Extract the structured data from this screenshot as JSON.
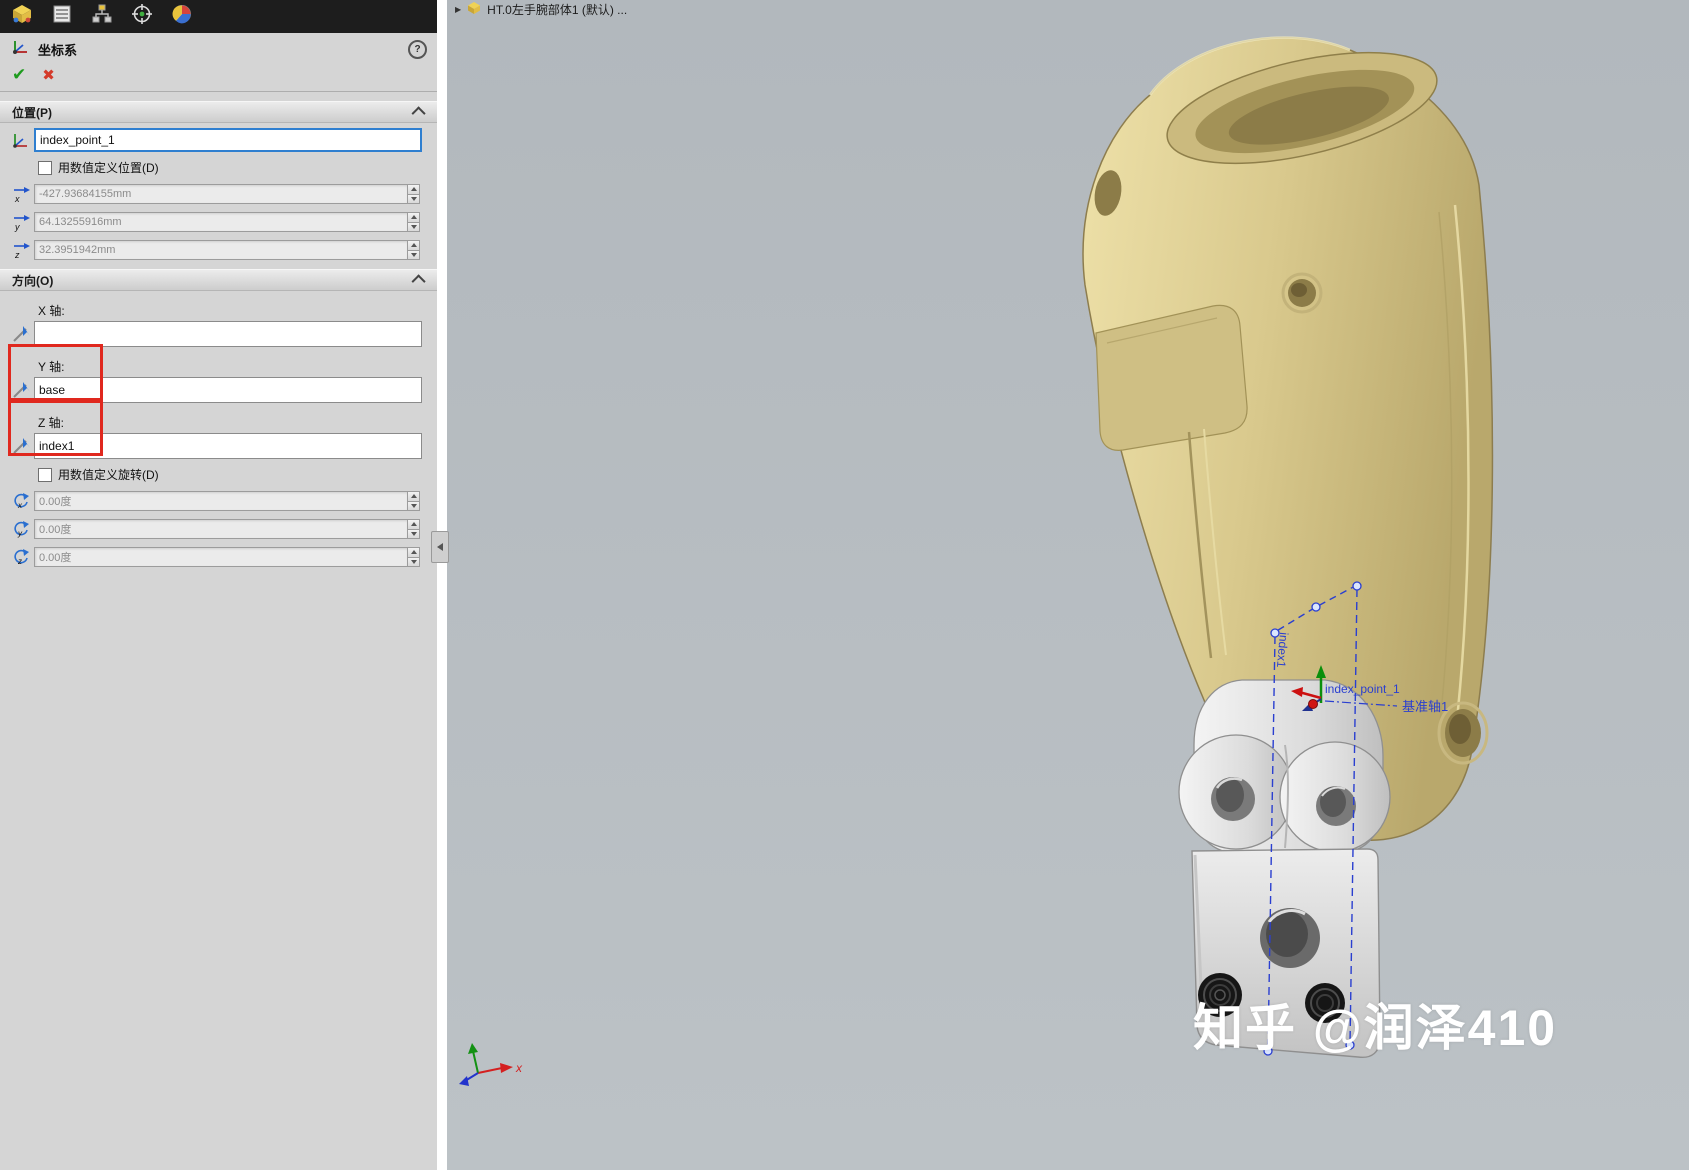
{
  "panel": {
    "tabs": [
      {
        "icon": "part-model-icon"
      },
      {
        "icon": "property-list-icon"
      },
      {
        "icon": "configuration-manager-icon"
      },
      {
        "icon": "dimxpert-target-icon"
      },
      {
        "icon": "display-manager-icon"
      }
    ],
    "title": "坐标系",
    "help_label": "?",
    "ok_label": "✔",
    "cancel_label": "✖",
    "position": {
      "header": "位置(P)",
      "name_value": "index_point_1",
      "checkbox_label": "用数值定义位置(D)",
      "fields": [
        {
          "axis": "x",
          "value": "-427.93684155mm"
        },
        {
          "axis": "y",
          "value": "64.13255916mm"
        },
        {
          "axis": "z",
          "value": "32.3951942mm"
        }
      ]
    },
    "direction": {
      "header": "方向(O)",
      "axes": [
        {
          "label": "X 轴:",
          "value": ""
        },
        {
          "label": "Y 轴:",
          "value": "base"
        },
        {
          "label": "Z 轴:",
          "value": "index1"
        }
      ],
      "checkbox_label": "用数值定义旋转(D)",
      "rotations": [
        {
          "axis": "x",
          "value": "0.00度"
        },
        {
          "axis": "y",
          "value": "0.00度"
        },
        {
          "axis": "z",
          "value": "0.00度"
        }
      ]
    }
  },
  "viewport": {
    "expander": "▶",
    "breadcrumb": "HT.0左手腕部体1 (默认) ...",
    "annotations": {
      "sketch_axis_label": "index1",
      "point_label": "index_point_1",
      "datum_axis_label": "基准轴1"
    },
    "triad_x_label": "x",
    "watermark": "知乎 @润泽410"
  },
  "colors": {
    "selection_border": "#2f7fd0",
    "annotation_red": "#e0281e",
    "construction_blue": "#2a3fd0",
    "model_tan": "#d8c88c",
    "viewport_background": "#b6bcc1"
  }
}
